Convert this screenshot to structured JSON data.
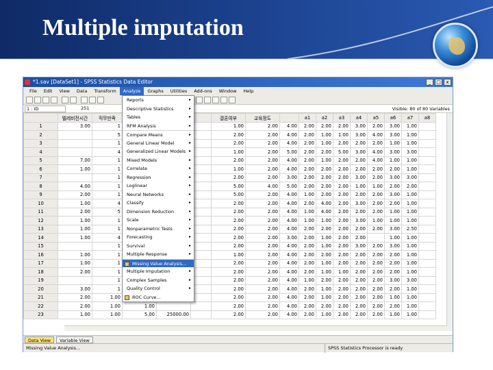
{
  "slide": {
    "title": "Multiple imputation"
  },
  "window": {
    "title": "*1.sav [DataSet1] - SPSS Statistics Data Editor",
    "min_btn": "_",
    "max_btn": "□",
    "close_btn": "x"
  },
  "menubar": [
    {
      "label": "File"
    },
    {
      "label": "Edit"
    },
    {
      "label": "View"
    },
    {
      "label": "Data"
    },
    {
      "label": "Transform"
    },
    {
      "label": "Analyze"
    },
    {
      "label": "Graphs"
    },
    {
      "label": "Utilities"
    },
    {
      "label": "Add-ons"
    },
    {
      "label": "Window"
    },
    {
      "label": "Help"
    }
  ],
  "refbar": {
    "cell": "1 : ID",
    "value": "251",
    "visible": "Visible: 80 of 80 Variables"
  },
  "analyze_menu": [
    {
      "label": "Reports",
      "arrow": "▸"
    },
    {
      "label": "Descriptive Statistics",
      "arrow": "▸"
    },
    {
      "label": "Tables",
      "arrow": "▸"
    },
    {
      "label": "RFM Analysis",
      "arrow": "▸"
    },
    {
      "label": "Compare Means",
      "arrow": "▸"
    },
    {
      "label": "General Linear Model",
      "arrow": "▸"
    },
    {
      "label": "Generalized Linear Models",
      "arrow": "▸"
    },
    {
      "label": "Mixed Models",
      "arrow": "▸"
    },
    {
      "label": "Correlate",
      "arrow": "▸"
    },
    {
      "label": "Regression",
      "arrow": "▸"
    },
    {
      "label": "Loglinear",
      "arrow": "▸"
    },
    {
      "label": "Neural Networks",
      "arrow": "▸"
    },
    {
      "label": "Classify",
      "arrow": "▸"
    },
    {
      "label": "Dimension Reduction",
      "arrow": "▸"
    },
    {
      "label": "Scale",
      "arrow": "▸"
    },
    {
      "label": "Nonparametric Tests",
      "arrow": "▸"
    },
    {
      "label": "Forecasting",
      "arrow": "▸"
    },
    {
      "label": "Survival",
      "arrow": "▸"
    },
    {
      "label": "Multiple Response",
      "arrow": "▸"
    },
    {
      "label": "Missing Value Analysis...",
      "arrow": ""
    },
    {
      "label": "Multiple Imputation",
      "arrow": "▸"
    },
    {
      "label": "Complex Samples",
      "arrow": "▸"
    },
    {
      "label": "Quality Control",
      "arrow": "▸"
    },
    {
      "label": "ROC Curve...",
      "arrow": ""
    }
  ],
  "grid": {
    "headers": [
      "",
      "",
      "",
      "",
      "",
      "결혼여부",
      "교육정도",
      "a1",
      "a2",
      "a3",
      "a4",
      "a5",
      "a6",
      "a7",
      "a8"
    ],
    "left_headers": [
      "",
      "텔레비전시간",
      "직무만족"
    ],
    "rows": [
      {
        "n": "1",
        "c1": "3.00",
        "c2": "1",
        "v": [
          "1.00",
          "2.00",
          "4.00",
          "2.00",
          "2.00",
          "2.00",
          "3.00",
          "2.00",
          "3.00",
          "1.00"
        ]
      },
      {
        "n": "2",
        "c1": "",
        "c2": "5",
        "v": [
          "2.00",
          "2.00",
          "4.00",
          "2.00",
          "1.00",
          "1.00",
          "3.00",
          "4.00",
          "3.00",
          "1.00"
        ]
      },
      {
        "n": "3",
        "c1": "",
        "c2": "1",
        "v": [
          "2.00",
          "2.00",
          "4.00",
          "2.00",
          "1.00",
          "2.00",
          "2.00",
          "2.00",
          "1.00",
          "1.00"
        ]
      },
      {
        "n": "4",
        "c1": "",
        "c2": "4",
        "v": [
          "1.00",
          "2.00",
          "5.00",
          "2.00",
          "2.00",
          "5.00",
          "3.00",
          "4.00",
          "3.00",
          "3.00"
        ]
      },
      {
        "n": "5",
        "c1": "7.00",
        "c2": "1",
        "v": [
          "2.00",
          "2.00",
          "4.00",
          "2.00",
          "1.00",
          "2.00",
          "2.00",
          "4.00",
          "1.00",
          "1.00"
        ]
      },
      {
        "n": "6",
        "c1": "1.00",
        "c2": "1",
        "v": [
          "1.00",
          "2.00",
          "4.00",
          "2.00",
          "2.00",
          "2.00",
          "2.00",
          "2.00",
          "2.00",
          "1.00"
        ]
      },
      {
        "n": "7",
        "c1": "",
        "c2": "1",
        "v": [
          "2.00",
          "2.00",
          "3.00",
          "2.00",
          "2.00",
          "2.00",
          "3.00",
          "2.00",
          "3.00",
          "3.00"
        ]
      },
      {
        "n": "8",
        "c1": "4.00",
        "c2": "1",
        "v": [
          "5.00",
          "4.00",
          "5.00",
          "2.00",
          "2.00",
          "2.00",
          "1.00",
          "1.00",
          "2.00",
          "2.00"
        ]
      },
      {
        "n": "9",
        "c1": "2.00",
        "c2": "1",
        "v": [
          "5.00",
          "2.00",
          "4.00",
          "1.00",
          "2.00",
          "2.00",
          "2.00",
          "2.00",
          "3.00",
          "1.00"
        ]
      },
      {
        "n": "10",
        "c1": "1.00",
        "c2": "4",
        "v": [
          "2.00",
          "2.00",
          "4.00",
          "2.00",
          "4.00",
          "2.00",
          "3.00",
          "2.00",
          "2.00",
          "1.00"
        ]
      },
      {
        "n": "11",
        "c1": "2.00",
        "c2": "5",
        "v": [
          "2.00",
          "2.00",
          "4.00",
          "1.00",
          "4.00",
          "2.00",
          "2.00",
          "2.00",
          "1.00",
          "1.00"
        ]
      },
      {
        "n": "12",
        "c1": "1.00",
        "c2": "1",
        "v": [
          "2.00",
          "2.00",
          "4.00",
          "1.00",
          "1.00",
          "2.00",
          "3.00",
          "1.00",
          "1.00",
          "1.00"
        ]
      },
      {
        "n": "13",
        "c1": "1.00",
        "c2": "1",
        "v": [
          "2.00",
          "2.00",
          "4.00",
          "2.00",
          "2.00",
          "2.00",
          "2.00",
          "2.00",
          "3.00",
          "2.50"
        ]
      },
      {
        "n": "14",
        "c1": "1.00",
        "c2": "4",
        "v": [
          "2.00",
          "2.00",
          "3.00",
          "2.00",
          "1.00",
          "2.00",
          "2.00",
          "",
          "1.00",
          "1.00"
        ]
      },
      {
        "n": "15",
        "c1": "",
        "c2": "1",
        "v": [
          "2.00",
          "2.00",
          "4.00",
          "2.00",
          "1.00",
          "2.00",
          "3.00",
          "2.00",
          "3.00",
          "1.00"
        ]
      },
      {
        "n": "16",
        "c1": "1.00",
        "c2": "1",
        "v": [
          "1.00",
          "2.00",
          "4.00",
          "2.00",
          "2.00",
          "2.00",
          "2.00",
          "2.00",
          "2.00",
          "1.00"
        ]
      },
      {
        "n": "17",
        "c1": "1.00",
        "c2": "1",
        "v": [
          "2.00",
          "2.00",
          "4.00",
          "2.00",
          "1.00",
          "2.00",
          "2.00",
          "2.00",
          "2.00",
          "1.00"
        ]
      },
      {
        "n": "18",
        "c1": "2.00",
        "c2": "1",
        "v": [
          "2.00",
          "2.00",
          "4.00",
          "2.00",
          "1.00",
          "1.00",
          "2.00",
          "2.00",
          "2.00",
          "1.00"
        ]
      },
      {
        "n": "19",
        "c1": "",
        "c2": "1",
        "v": [
          "2.00",
          "2.00",
          "4.00",
          "1.00",
          "2.00",
          "2.00",
          "2.00",
          "2.00",
          "3.00",
          "3.00"
        ]
      },
      {
        "n": "20",
        "c1": "3.00",
        "c2": "1",
        "v": [
          "2.00",
          "2.00",
          "4.00",
          "2.00",
          "1.00",
          "2.00",
          "2.00",
          "2.00",
          "2.00",
          "1.00"
        ]
      },
      {
        "n": "21",
        "c1": "2.00",
        "c2": "1.00",
        "v": [
          "2.00",
          "2.00",
          "4.00",
          "2.00",
          "1.00",
          "2.00",
          "2.00",
          "2.00",
          "1.00",
          "1.00"
        ]
      },
      {
        "n": "22",
        "c1": "2.00",
        "c2": "1.00",
        "v": [
          "2.00",
          "2.00",
          "4.00",
          "2.00",
          "2.00",
          "2.00",
          "2.00",
          "2.00",
          "2.00",
          "1.00"
        ]
      },
      {
        "n": "23",
        "c1": "1.00",
        "c2": "1.00",
        "v": [
          "2.00",
          "2.00",
          "4.00",
          "2.00",
          "1.00",
          "2.00",
          "2.00",
          "2.00",
          "1.00",
          "1.00"
        ]
      }
    ],
    "extra": {
      "r21_c3": "1.00",
      "r22_c3": "1.00",
      "r23_c3": "5.00",
      "r23_c4": "25000.00"
    }
  },
  "tabs": {
    "data_view": "Data View",
    "variable_view": "Variable View"
  },
  "status": {
    "left": "Missing Value Analysis...",
    "right": "SPSS Statistics Processor is ready"
  },
  "colors": {
    "header_dark": "#0f2a66",
    "header_light": "#2a5ab2",
    "highlight": "#316ac5"
  }
}
